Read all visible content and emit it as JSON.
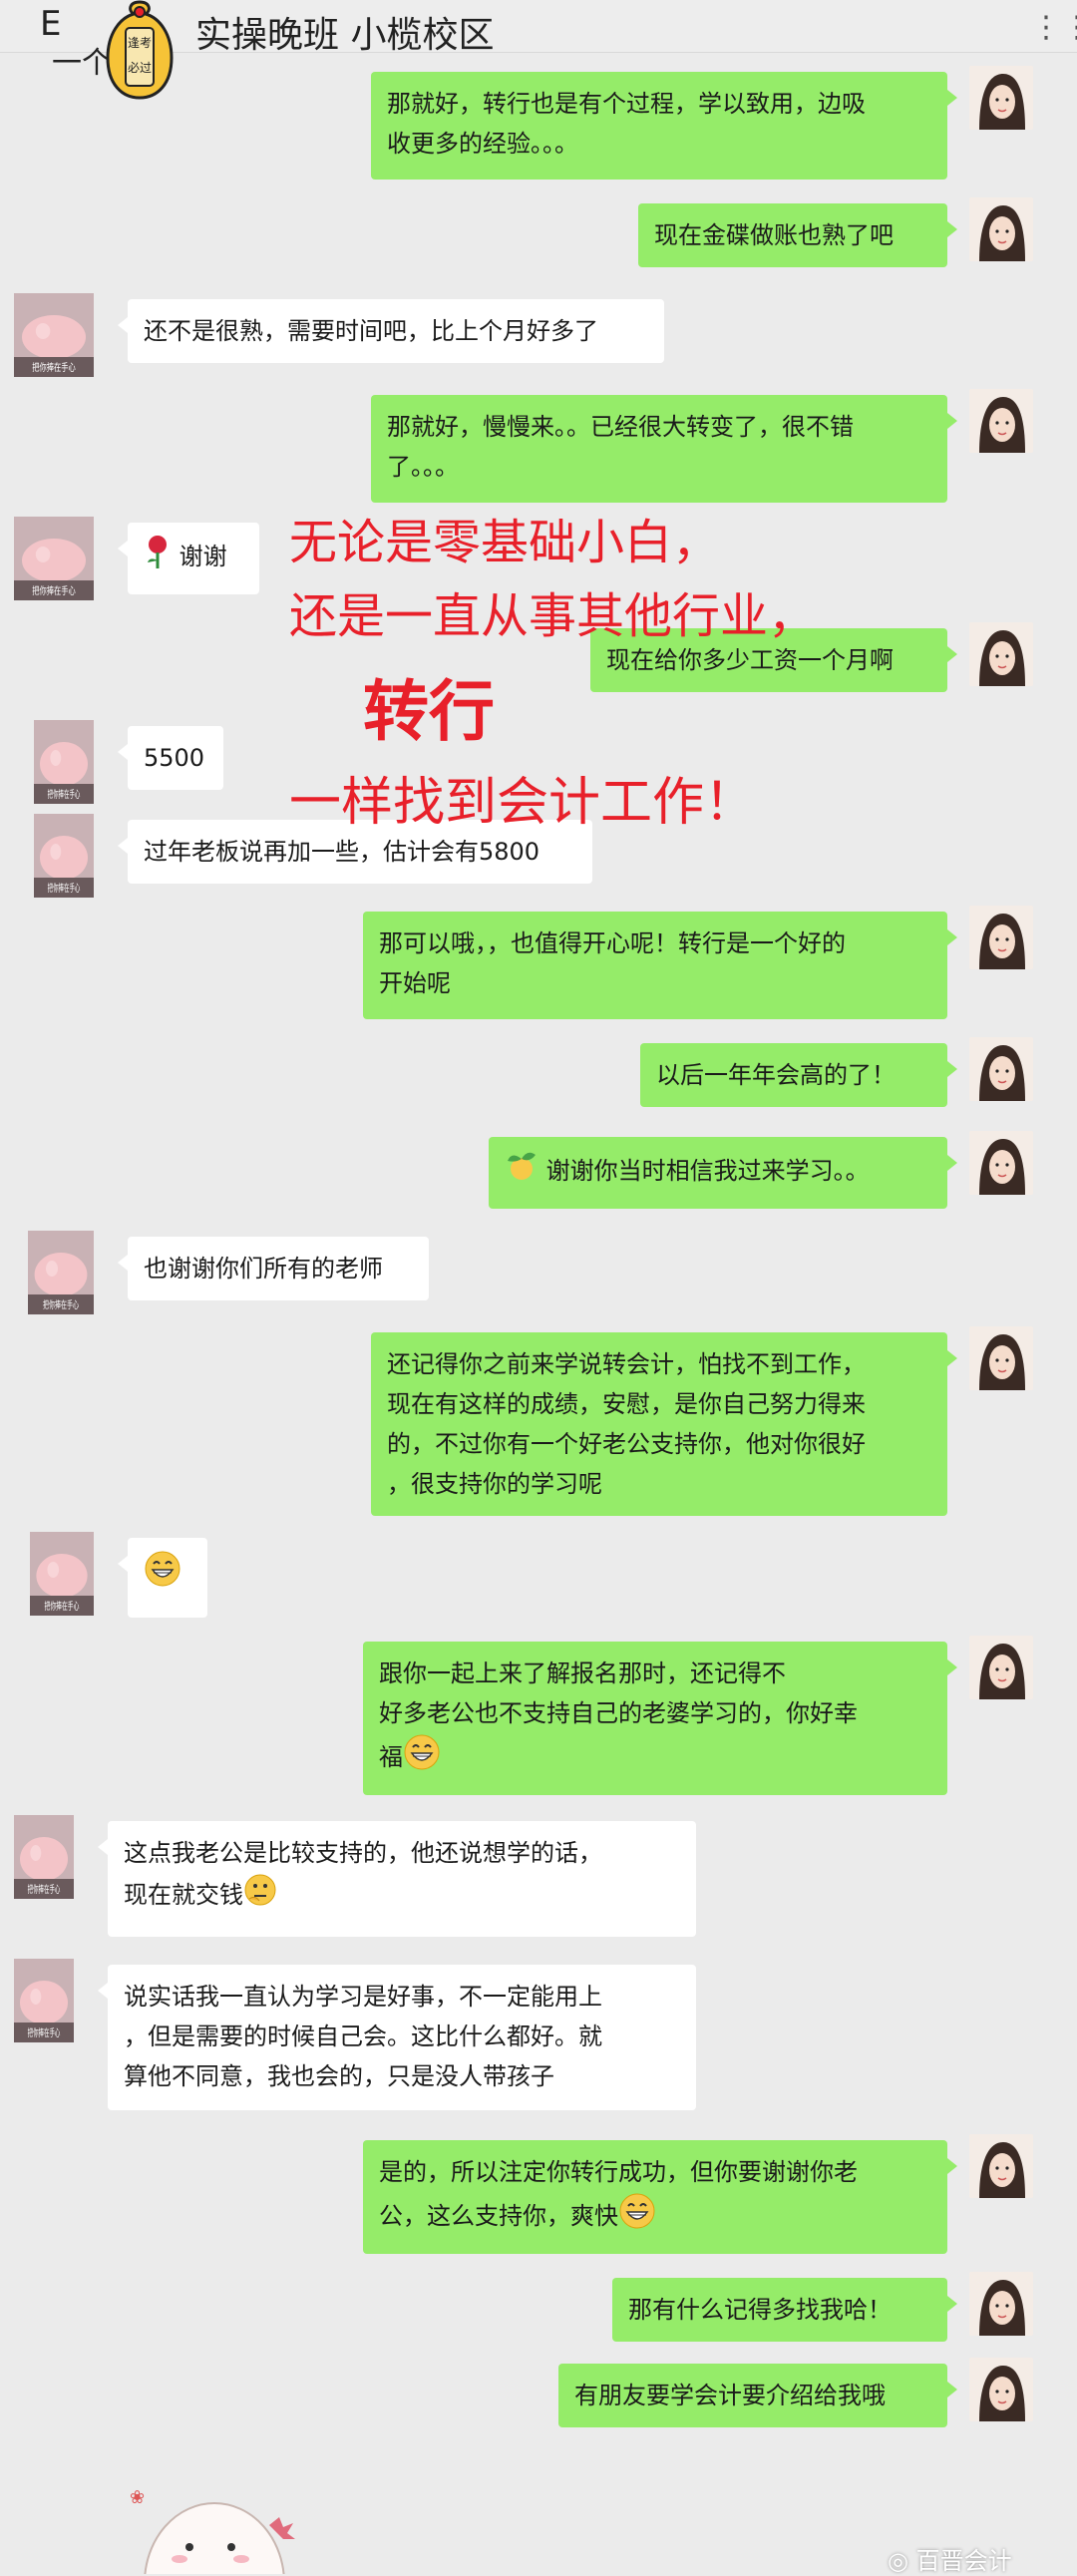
{
  "header": {
    "title_prefix": "E",
    "title_sub": "一个",
    "title": "实操晚班 小榄校区",
    "more_label": "⋮⋮",
    "sticker_text": "逢考必过"
  },
  "overlay": {
    "line1": "无论是零基础小白，",
    "line2": "还是一直从事其他行业，",
    "line3": "转行",
    "line4": "一样找到会计工作！"
  },
  "avatar_caption": "把你捧在手心",
  "messages": [
    {
      "side": "right",
      "text": "那就好，转行也是有个过程，学以致用，边吸\n收更多的经验。。。"
    },
    {
      "side": "right",
      "text": "现在金碟做账也熟了吧"
    },
    {
      "side": "left",
      "text": "还不是很熟，需要时间吧，比上个月好多了"
    },
    {
      "side": "right",
      "text": "那就好，慢慢来。。已经很大转变了，很不错\n了。。。"
    },
    {
      "side": "left",
      "text": "谢谢"
    },
    {
      "side": "right",
      "text": "现在给你多少工资一个月啊"
    },
    {
      "side": "left",
      "text": "5500"
    },
    {
      "side": "left",
      "text": "过年老板说再加一些，估计会有5800"
    },
    {
      "side": "right",
      "text": "那可以哦，，也值得开心呢！转行是一个好的\n开始呢"
    },
    {
      "side": "right",
      "text": "以后一年年会高的了！"
    },
    {
      "side": "right",
      "text": "谢谢你当时相信我过来学习。。"
    },
    {
      "side": "left",
      "text": "也谢谢你们所有的老师"
    },
    {
      "side": "right",
      "text": "还记得你之前来学说转会计，怕找不到工作，\n现在有这样的成绩，安慰，是你自己努力得来\n的，不过你有一个好老公支持你，他对你很好\n，很支持你的学习呢"
    },
    {
      "side": "left",
      "text": ""
    },
    {
      "side": "right",
      "text": "跟你一起上来了解报名那时，还记得不\n好多老公也不支持自己的老婆学习的，你好幸\n福"
    },
    {
      "side": "left",
      "text": "这点我老公是比较支持的，他还说想学的话，\n现在就交钱"
    },
    {
      "side": "left",
      "text": "说实话我一直认为学习是好事，不一定能用上\n，但是需要的时候自己会。这比什么都好。就\n算他不同意，我也会的，只是没人带孩子"
    },
    {
      "side": "right",
      "text": "是的，所以注定你转行成功，但你要谢谢你老\n公，这么支持你，爽快"
    },
    {
      "side": "right",
      "text": "那有什么记得多找我哈！"
    },
    {
      "side": "right",
      "text": "有朋友要学会计要介绍给我哦"
    }
  ],
  "watermark": "百晋会计",
  "colors": {
    "right_bubble": "#95ec69",
    "left_bubble": "#ffffff",
    "overlay": "#e8202a",
    "background": "#ebebeb"
  }
}
